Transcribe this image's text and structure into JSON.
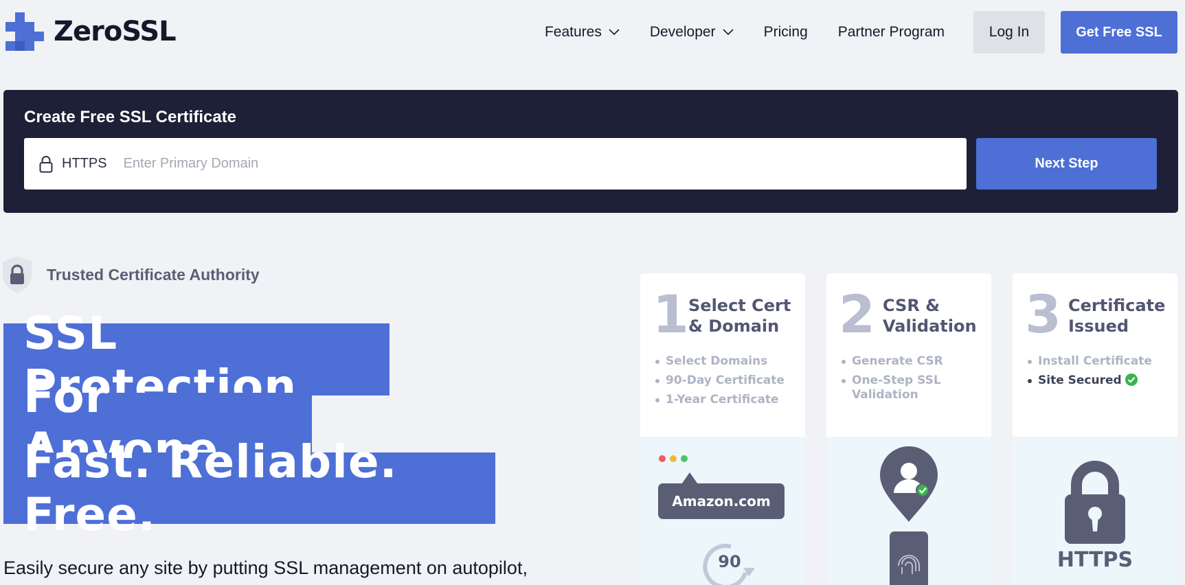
{
  "header": {
    "brand": "ZeroSSL",
    "nav": [
      {
        "label": "Features",
        "dropdown": true
      },
      {
        "label": "Developer",
        "dropdown": true
      },
      {
        "label": "Pricing",
        "dropdown": false
      },
      {
        "label": "Partner Program",
        "dropdown": false
      }
    ],
    "login_label": "Log In",
    "cta_label": "Get Free SSL"
  },
  "create": {
    "title": "Create Free SSL Certificate",
    "prefix": "HTTPS",
    "placeholder": "Enter Primary Domain",
    "value": "",
    "next_label": "Next Step"
  },
  "hero": {
    "trusted": "Trusted Certificate Authority",
    "headline": [
      "SSL Protection",
      "For Anyone",
      "Fast. Reliable. Free."
    ],
    "subtext": "Easily secure any site by putting SSL management on autopilot,"
  },
  "steps": [
    {
      "num": "1",
      "title": "Select Cert & Domain",
      "items": [
        "Select Domains",
        "90-Day Certificate",
        "1-Year Certificate"
      ],
      "illustration": {
        "site": "Amazon.com",
        "days": "90"
      }
    },
    {
      "num": "2",
      "title": "CSR & Validation",
      "items": [
        "Generate CSR",
        "One-Step SSL Validation"
      ]
    },
    {
      "num": "3",
      "title": "Certificate Issued",
      "items": [
        "Install Certificate",
        "Site Secured"
      ],
      "illustration": {
        "label": "HTTPS"
      }
    }
  ],
  "colors": {
    "accent": "#4d6fd6",
    "panel": "#1d2036",
    "background": "#f1f2f5",
    "success": "#39b54a"
  }
}
